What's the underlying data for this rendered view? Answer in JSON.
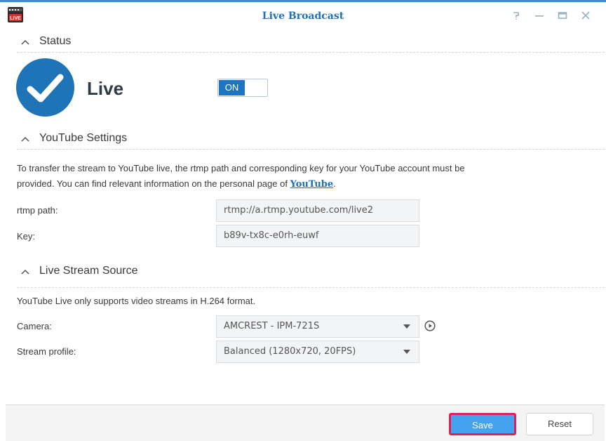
{
  "window": {
    "title": "Live Broadcast",
    "icon": "live-broadcast-app-icon",
    "controls": {
      "help": "?",
      "minimize": "—",
      "maximize": "□",
      "close": "×"
    },
    "accent_color": "#1f74b8"
  },
  "sections": {
    "status": {
      "title": "Status",
      "live_label": "Live",
      "toggle_label": "ON"
    },
    "youtube": {
      "title": "YouTube Settings",
      "description_line1": "To transfer the stream to YouTube live, the rtmp path and corresponding key for your YouTube account must be",
      "description_line2_prefix": "provided. You can find relevant information on the personal page of ",
      "link_text": "YouTube",
      "description_line2_suffix": ".",
      "rtmp_label": "rtmp path:",
      "rtmp_value": "rtmp://a.rtmp.youtube.com/live2",
      "key_label": "Key:",
      "key_value": "b89v-tx8c-e0rh-euwf"
    },
    "source": {
      "title": "Live Stream Source",
      "description": "YouTube Live only supports video streams in H.264 format.",
      "camera_label": "Camera:",
      "camera_value": "AMCREST - IPM-721S",
      "profile_label": "Stream profile:",
      "profile_value": "Balanced (1280x720, 20FPS)"
    }
  },
  "footer": {
    "save_label": "Save",
    "reset_label": "Reset"
  }
}
